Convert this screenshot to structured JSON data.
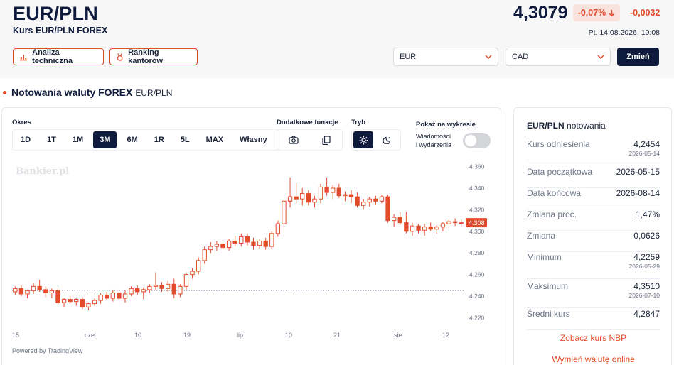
{
  "header": {
    "pair": "EUR/PLN",
    "subtitle": "Kurs EUR/PLN FOREX",
    "price": "4,3079",
    "change_pct": "-0,07%",
    "change_abs": "-0,0032",
    "timestamp": "Pt. 14.08.2026, 10:08",
    "btn_analysis": "Analiza techniczna",
    "btn_ranking": "Ranking kantorów",
    "select_from": "EUR",
    "select_to": "CAD",
    "btn_change": "Zmień",
    "colors": {
      "accent": "#e24b2b",
      "navy": "#0f1b3d"
    }
  },
  "section": {
    "title": "Notowania waluty FOREX",
    "pair": "EUR/PLN"
  },
  "controls": {
    "period_label": "Okres",
    "periods": [
      "1D",
      "1T",
      "1M",
      "3M",
      "6M",
      "1R",
      "5L",
      "MAX",
      "Własny"
    ],
    "active_period": "3M",
    "functions_label": "Dodatkowe funkcje",
    "mode_label": "Tryb",
    "show_label": "Pokaż na wykresie",
    "news_line1": "Wiadomości",
    "news_line2": "i wydarzenia",
    "news_toggle_on": false
  },
  "chart_watermark": "Bankier.pl",
  "powered_by": "Powered by TradingView",
  "chart_data": {
    "type": "candlestick",
    "y_ticks": [
      "4.220",
      "4.240",
      "4.260",
      "4.280",
      "4.300",
      "4.320",
      "4.340",
      "4.360"
    ],
    "ylim": [
      4.215,
      4.365
    ],
    "x_ticks": [
      "15",
      "cze",
      "10",
      "19",
      "lip",
      "10",
      "21",
      "sie",
      "12"
    ],
    "last_price_label": "4.308",
    "reference_line": 4.2454,
    "candles": [
      {
        "o": 4.244,
        "h": 4.249,
        "l": 4.241,
        "c": 4.247
      },
      {
        "o": 4.247,
        "h": 4.25,
        "l": 4.24,
        "c": 4.242
      },
      {
        "o": 4.242,
        "h": 4.246,
        "l": 4.238,
        "c": 4.245
      },
      {
        "o": 4.245,
        "h": 4.252,
        "l": 4.242,
        "c": 4.249
      },
      {
        "o": 4.249,
        "h": 4.255,
        "l": 4.244,
        "c": 4.246
      },
      {
        "o": 4.246,
        "h": 4.249,
        "l": 4.239,
        "c": 4.243
      },
      {
        "o": 4.243,
        "h": 4.247,
        "l": 4.238,
        "c": 4.245
      },
      {
        "o": 4.245,
        "h": 4.247,
        "l": 4.232,
        "c": 4.234
      },
      {
        "o": 4.234,
        "h": 4.238,
        "l": 4.23,
        "c": 4.237
      },
      {
        "o": 4.237,
        "h": 4.24,
        "l": 4.233,
        "c": 4.235
      },
      {
        "o": 4.235,
        "h": 4.238,
        "l": 4.231,
        "c": 4.237
      },
      {
        "o": 4.237,
        "h": 4.239,
        "l": 4.228,
        "c": 4.23
      },
      {
        "o": 4.23,
        "h": 4.234,
        "l": 4.227,
        "c": 4.233
      },
      {
        "o": 4.233,
        "h": 4.238,
        "l": 4.231,
        "c": 4.236
      },
      {
        "o": 4.236,
        "h": 4.243,
        "l": 4.233,
        "c": 4.241
      },
      {
        "o": 4.241,
        "h": 4.244,
        "l": 4.236,
        "c": 4.238
      },
      {
        "o": 4.238,
        "h": 4.246,
        "l": 4.235,
        "c": 4.243
      },
      {
        "o": 4.243,
        "h": 4.246,
        "l": 4.236,
        "c": 4.238
      },
      {
        "o": 4.238,
        "h": 4.245,
        "l": 4.234,
        "c": 4.242
      },
      {
        "o": 4.242,
        "h": 4.249,
        "l": 4.24,
        "c": 4.247
      },
      {
        "o": 4.247,
        "h": 4.25,
        "l": 4.241,
        "c": 4.244
      },
      {
        "o": 4.244,
        "h": 4.248,
        "l": 4.237,
        "c": 4.246
      },
      {
        "o": 4.246,
        "h": 4.251,
        "l": 4.243,
        "c": 4.249
      },
      {
        "o": 4.249,
        "h": 4.262,
        "l": 4.246,
        "c": 4.25
      },
      {
        "o": 4.25,
        "h": 4.253,
        "l": 4.244,
        "c": 4.247
      },
      {
        "o": 4.247,
        "h": 4.254,
        "l": 4.244,
        "c": 4.251
      },
      {
        "o": 4.251,
        "h": 4.256,
        "l": 4.238,
        "c": 4.242
      },
      {
        "o": 4.242,
        "h": 4.251,
        "l": 4.239,
        "c": 4.249
      },
      {
        "o": 4.249,
        "h": 4.262,
        "l": 4.246,
        "c": 4.26
      },
      {
        "o": 4.26,
        "h": 4.266,
        "l": 4.256,
        "c": 4.263
      },
      {
        "o": 4.263,
        "h": 4.276,
        "l": 4.26,
        "c": 4.273
      },
      {
        "o": 4.273,
        "h": 4.286,
        "l": 4.27,
        "c": 4.283
      },
      {
        "o": 4.283,
        "h": 4.29,
        "l": 4.28,
        "c": 4.286
      },
      {
        "o": 4.286,
        "h": 4.291,
        "l": 4.282,
        "c": 4.288
      },
      {
        "o": 4.288,
        "h": 4.292,
        "l": 4.283,
        "c": 4.285
      },
      {
        "o": 4.285,
        "h": 4.293,
        "l": 4.282,
        "c": 4.291
      },
      {
        "o": 4.291,
        "h": 4.296,
        "l": 4.286,
        "c": 4.289
      },
      {
        "o": 4.289,
        "h": 4.298,
        "l": 4.286,
        "c": 4.295
      },
      {
        "o": 4.295,
        "h": 4.298,
        "l": 4.287,
        "c": 4.29
      },
      {
        "o": 4.29,
        "h": 4.294,
        "l": 4.283,
        "c": 4.287
      },
      {
        "o": 4.287,
        "h": 4.293,
        "l": 4.284,
        "c": 4.291
      },
      {
        "o": 4.291,
        "h": 4.294,
        "l": 4.283,
        "c": 4.286
      },
      {
        "o": 4.286,
        "h": 4.3,
        "l": 4.284,
        "c": 4.298
      },
      {
        "o": 4.298,
        "h": 4.31,
        "l": 4.295,
        "c": 4.307
      },
      {
        "o": 4.307,
        "h": 4.33,
        "l": 4.304,
        "c": 4.328
      },
      {
        "o": 4.328,
        "h": 4.35,
        "l": 4.322,
        "c": 4.332
      },
      {
        "o": 4.332,
        "h": 4.345,
        "l": 4.326,
        "c": 4.33
      },
      {
        "o": 4.33,
        "h": 4.34,
        "l": 4.324,
        "c": 4.335
      },
      {
        "o": 4.335,
        "h": 4.338,
        "l": 4.324,
        "c": 4.327
      },
      {
        "o": 4.327,
        "h": 4.333,
        "l": 4.322,
        "c": 4.33
      },
      {
        "o": 4.33,
        "h": 4.344,
        "l": 4.326,
        "c": 4.341
      },
      {
        "o": 4.341,
        "h": 4.35,
        "l": 4.333,
        "c": 4.336
      },
      {
        "o": 4.336,
        "h": 4.343,
        "l": 4.33,
        "c": 4.34
      },
      {
        "o": 4.34,
        "h": 4.344,
        "l": 4.331,
        "c": 4.333
      },
      {
        "o": 4.333,
        "h": 4.337,
        "l": 4.328,
        "c": 4.334
      },
      {
        "o": 4.334,
        "h": 4.338,
        "l": 4.326,
        "c": 4.332
      },
      {
        "o": 4.332,
        "h": 4.336,
        "l": 4.322,
        "c": 4.324
      },
      {
        "o": 4.324,
        "h": 4.33,
        "l": 4.32,
        "c": 4.327
      },
      {
        "o": 4.327,
        "h": 4.332,
        "l": 4.323,
        "c": 4.33
      },
      {
        "o": 4.33,
        "h": 4.333,
        "l": 4.325,
        "c": 4.328
      },
      {
        "o": 4.328,
        "h": 4.334,
        "l": 4.326,
        "c": 4.332
      },
      {
        "o": 4.332,
        "h": 4.334,
        "l": 4.308,
        "c": 4.31
      },
      {
        "o": 4.31,
        "h": 4.316,
        "l": 4.304,
        "c": 4.313
      },
      {
        "o": 4.313,
        "h": 4.318,
        "l": 4.306,
        "c": 4.308
      },
      {
        "o": 4.308,
        "h": 4.318,
        "l": 4.298,
        "c": 4.3
      },
      {
        "o": 4.3,
        "h": 4.308,
        "l": 4.296,
        "c": 4.305
      },
      {
        "o": 4.305,
        "h": 4.307,
        "l": 4.298,
        "c": 4.301
      },
      {
        "o": 4.301,
        "h": 4.307,
        "l": 4.296,
        "c": 4.304
      },
      {
        "o": 4.304,
        "h": 4.308,
        "l": 4.3,
        "c": 4.302
      },
      {
        "o": 4.302,
        "h": 4.306,
        "l": 4.298,
        "c": 4.304
      },
      {
        "o": 4.304,
        "h": 4.309,
        "l": 4.3,
        "c": 4.307
      },
      {
        "o": 4.307,
        "h": 4.311,
        "l": 4.303,
        "c": 4.309
      },
      {
        "o": 4.309,
        "h": 4.312,
        "l": 4.305,
        "c": 4.308
      },
      {
        "o": 4.308,
        "h": 4.311,
        "l": 4.304,
        "c": 4.308
      }
    ]
  },
  "stats": {
    "title_pair": "EUR/PLN",
    "title_rest": "notowania",
    "rows": [
      {
        "label": "Kurs odniesienia",
        "value": "4,2454",
        "date": "2026-05-14"
      },
      {
        "label": "Data początkowa",
        "value": "2026-05-15",
        "date": ""
      },
      {
        "label": "Data końcowa",
        "value": "2026-08-14",
        "date": ""
      },
      {
        "label": "Zmiana proc.",
        "value": "1,47%",
        "date": ""
      },
      {
        "label": "Zmiana",
        "value": "0,0626",
        "date": ""
      },
      {
        "label": "Minimum",
        "value": "4,2259",
        "date": "2026-05-29"
      },
      {
        "label": "Maksimum",
        "value": "4,3510",
        "date": "2026-07-10"
      },
      {
        "label": "Średni kurs",
        "value": "4,2847",
        "date": ""
      }
    ],
    "link_nbp": "Zobacz kurs NBP",
    "link_exchange": "Wymień walutę online"
  }
}
